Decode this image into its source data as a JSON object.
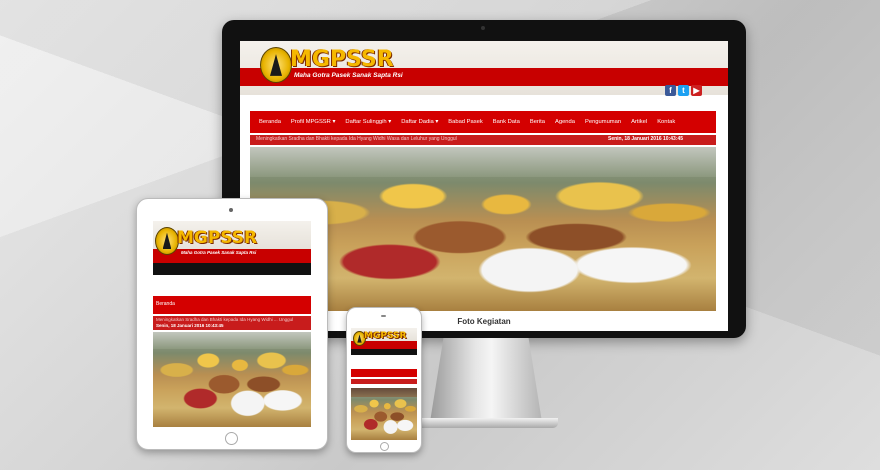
{
  "site": {
    "logo_text": "MGPSSR",
    "logo_subtitle": "Maha Gotra Pasek Sanak Sapta Rsi",
    "brand_red": "#c80000",
    "logo_gold": "#f5b800"
  },
  "desktop": {
    "nav": [
      "Beranda",
      "Profil MPGSSR",
      "Daftar Sulinggih",
      "Daftar Dadia",
      "Babad Pasek",
      "Bank Data",
      "Berita",
      "Agenda",
      "Pengumuman",
      "Artikel",
      "Kontak"
    ],
    "nav_dropdown": [
      false,
      true,
      true,
      true,
      false,
      false,
      false,
      false,
      false,
      false,
      false
    ],
    "marquee": "Meningkatkan Sradha dan Bhakti kepada Ida Hyang Widhi Wasa dan Leluhur yang Unggul",
    "date": "Senin, 18 Januari 2016 10:43:45",
    "section_title": "Foto Kegiatan",
    "social": [
      "f",
      "t",
      "▶"
    ]
  },
  "tablet": {
    "nav_item": "Beranda",
    "marquee": "Meningkatkan Sradha dan Bhakti kepada Ida Hyang Widhi ... Unggul",
    "date": "Senin, 18 Januari 2016 10:43:45"
  },
  "phone": {}
}
